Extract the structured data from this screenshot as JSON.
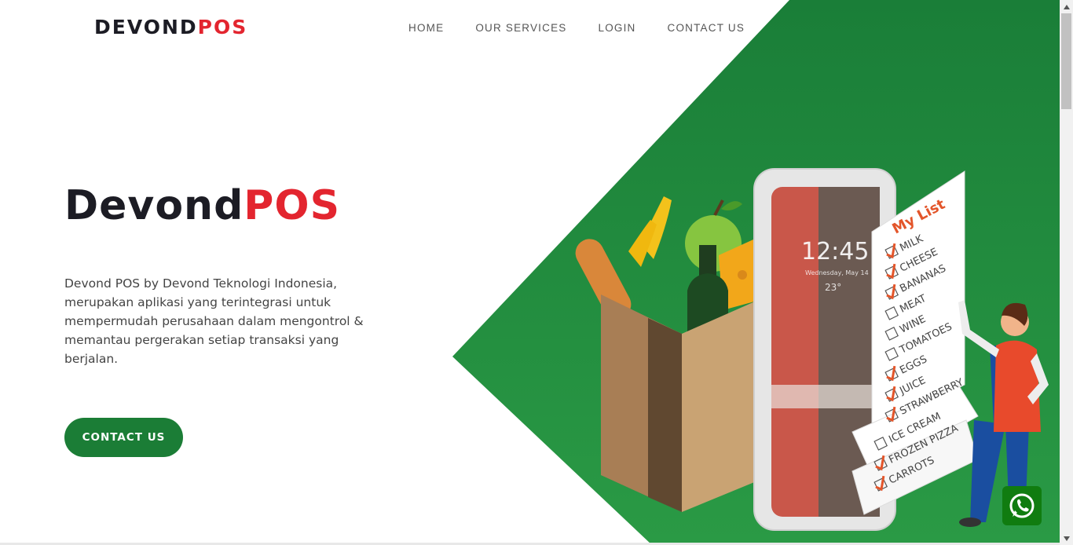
{
  "header": {
    "logo_main": "DEVOND",
    "logo_accent": "POS",
    "nav": [
      {
        "label": "HOME"
      },
      {
        "label": "OUR SERVICES"
      },
      {
        "label": "LOGIN"
      },
      {
        "label": "CONTACT US"
      }
    ]
  },
  "hero": {
    "title_main": "Devond",
    "title_accent": "POS",
    "description": "Devond POS by Devond Teknologi Indonesia, merupakan aplikasi yang terintegrasi untuk mempermudah perusahaan dalam mengontrol & memantau pergerakan setiap transaksi yang berjalan.",
    "cta_label": "CONTACT US"
  },
  "illustration": {
    "phone_time": "12:45",
    "phone_date": "Wednesday, May 14",
    "phone_temp": "23°",
    "list_title": "My List",
    "list_items": [
      {
        "label": "MILK",
        "checked": true
      },
      {
        "label": "CHEESE",
        "checked": true
      },
      {
        "label": "BANANAS",
        "checked": true
      },
      {
        "label": "MEAT",
        "checked": false
      },
      {
        "label": "WINE",
        "checked": false
      },
      {
        "label": "TOMATOES",
        "checked": false
      },
      {
        "label": "EGGS",
        "checked": true
      },
      {
        "label": "JUICE",
        "checked": true
      },
      {
        "label": "STRAWBERRY",
        "checked": true
      },
      {
        "label": "ICE CREAM",
        "checked": false
      },
      {
        "label": "FROZEN PIZZA",
        "checked": true
      },
      {
        "label": "CARROTS",
        "checked": true
      }
    ]
  },
  "whatsapp": {
    "icon": "whatsapp-icon"
  },
  "colors": {
    "brand_red": "#e3252f",
    "brand_green": "#1b7d36",
    "dark": "#1c1c24"
  }
}
